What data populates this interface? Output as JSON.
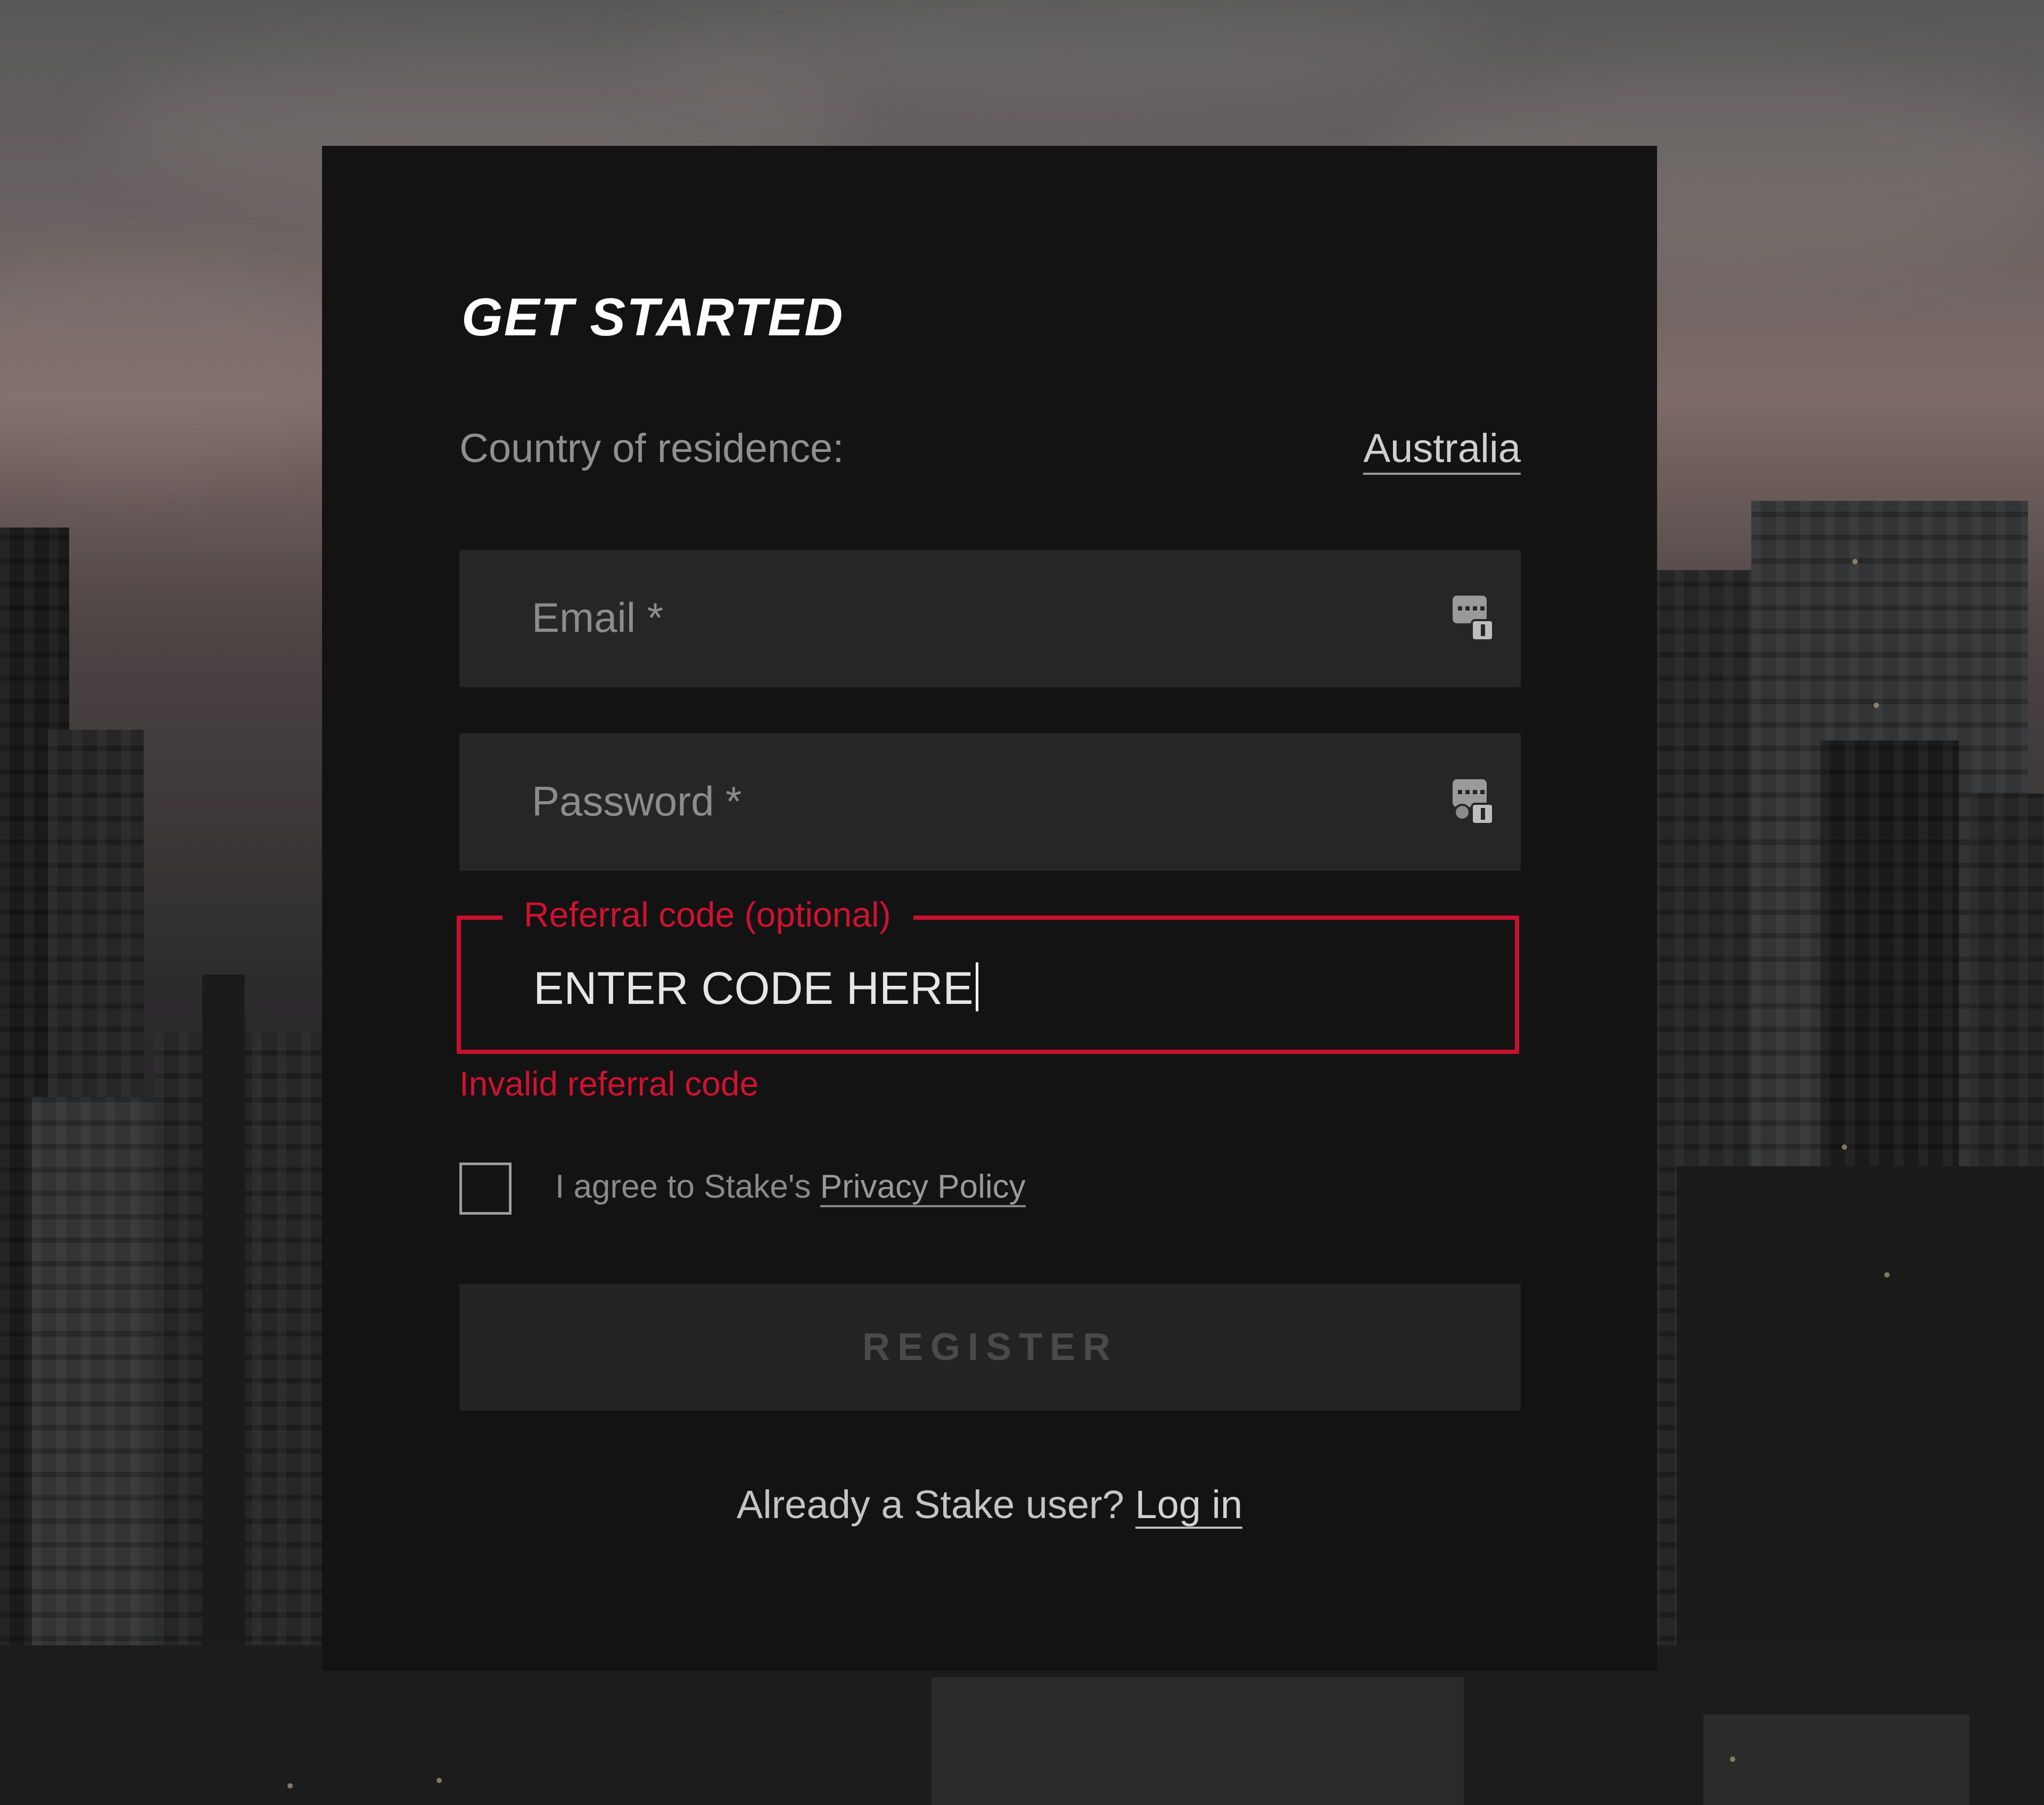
{
  "page": {
    "title": "GET STARTED"
  },
  "country": {
    "label": "Country of residence:",
    "value": "Australia"
  },
  "fields": {
    "email_placeholder": "Email *",
    "password_placeholder": "Password *",
    "referral_label": "Referral code (optional)",
    "referral_value": "ENTER CODE HERE",
    "referral_error": "Invalid referral code"
  },
  "agreement": {
    "text": "I agree to Stake's",
    "link": "Privacy Policy",
    "checked": false
  },
  "register": {
    "label": "REGISTER"
  },
  "footer": {
    "text": "Already a Stake user?",
    "link": "Log in"
  },
  "icons": {
    "password_manager": "password-manager-key-icon"
  },
  "colors": {
    "error": "#d0122f",
    "card_background": "#131314",
    "field_background": "#262627"
  }
}
